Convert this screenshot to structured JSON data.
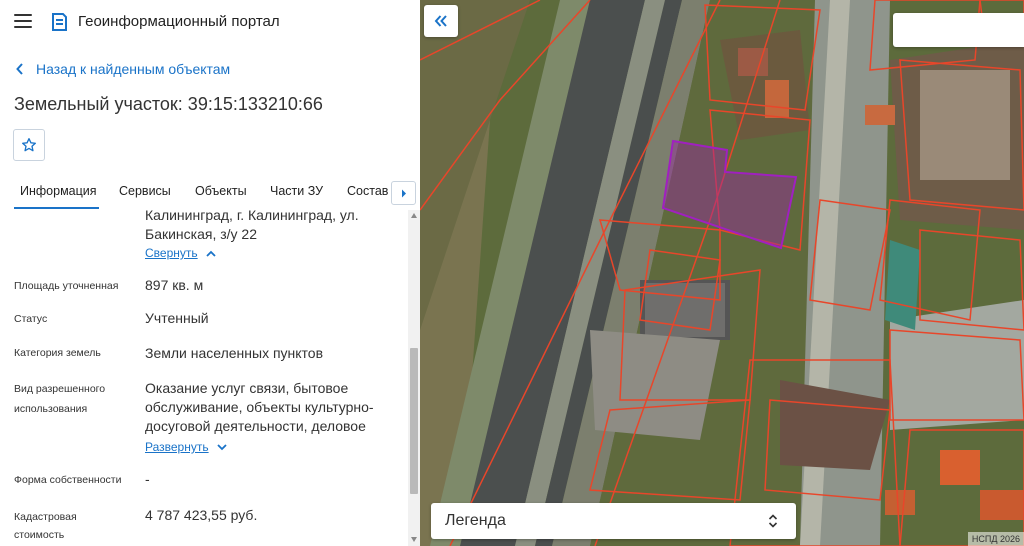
{
  "header": {
    "app_title": "Геоинформационный портал",
    "menu_icon": "hamburger-menu-icon",
    "logo_icon": "portal-logo-icon"
  },
  "nav": {
    "back_label": "Назад к найденным объектам"
  },
  "object": {
    "title": "Земельный участок: 39:15:133210:66",
    "favorite_icon": "star-outline-icon"
  },
  "tabs": [
    {
      "label": "Информация",
      "active": true
    },
    {
      "label": "Сервисы"
    },
    {
      "label": "Объекты"
    },
    {
      "label": "Части ЗУ"
    },
    {
      "label": "Состав"
    }
  ],
  "info": {
    "address_line1": "Калининград, г. Калининград, ул.",
    "address_line2": "Бакинская, з/у 22",
    "collapse_label": "Свернуть",
    "area": {
      "label": "Площадь уточненная",
      "value": "897 кв. м"
    },
    "status": {
      "label": "Статус",
      "value": "Учтенный"
    },
    "category": {
      "label": "Категория земель",
      "value": "Земли населенных пунктов"
    },
    "usage": {
      "label_line1": "Вид разрешенного",
      "label_line2": "использования",
      "value_line1": "Оказание услуг связи, бытовое",
      "value_line2": "обслуживание, объекты культурно-",
      "value_line3": "досуговой деятельности, деловое",
      "expand_label": "Развернуть"
    },
    "ownership": {
      "label": "Форма собственности",
      "value": "-"
    },
    "cost": {
      "label_line1": "Кадастровая",
      "label_line2": "стоимость",
      "value": "4 787 423,55 руб."
    }
  },
  "map": {
    "legend_label": "Легенда",
    "attribution": "НСПД 2026",
    "colors": {
      "parcel_border": "#e8462a",
      "selected_parcel": "#a020c0",
      "accent": "#1a73c8"
    }
  }
}
